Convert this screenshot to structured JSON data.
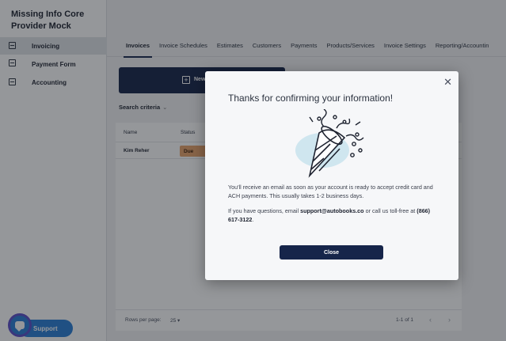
{
  "app": {
    "title": "Missing Info Core Provider Mock"
  },
  "sidebar": {
    "items": [
      {
        "label": "Invoicing",
        "icon": "grid-icon",
        "active": true
      },
      {
        "label": "Payment Form",
        "icon": "card-icon",
        "active": false
      },
      {
        "label": "Accounting",
        "icon": "ledger-icon",
        "active": false
      }
    ],
    "support_label": "Support"
  },
  "tabs": [
    {
      "label": "Invoices",
      "active": true
    },
    {
      "label": "Invoice Schedules"
    },
    {
      "label": "Estimates"
    },
    {
      "label": "Customers"
    },
    {
      "label": "Payments"
    },
    {
      "label": "Products/Services"
    },
    {
      "label": "Invoice Settings"
    },
    {
      "label": "Reporting/Accountin"
    }
  ],
  "main": {
    "new_button_label": "New",
    "search_criteria_label": "Search criteria",
    "table": {
      "headers": [
        "Name",
        "Status"
      ],
      "rows": [
        {
          "name": "Kim Reher",
          "status": "Due"
        }
      ]
    },
    "pager": {
      "rows_per_page_label": "Rows per page:",
      "rows_per_page_value": "25",
      "count": "1-1 of 1"
    }
  },
  "modal": {
    "title": "Thanks for confirming your information!",
    "message1": "You'll receive an email as soon as your account is ready to accept credit card and ACH payments. This usually takes 1-2 business days.",
    "message2_prefix": "If you have questions, email ",
    "email": "support@autobooks.co",
    "message2_mid": " or call us toll-free at ",
    "phone": "(866) 617-3122",
    "message2_suffix": ".",
    "close_button_label": "Close"
  },
  "colors": {
    "primary": "#16254a",
    "status_due": "#e8a36a",
    "support": "#2a7fd6",
    "illustration_blob": "#cfe6ef"
  }
}
